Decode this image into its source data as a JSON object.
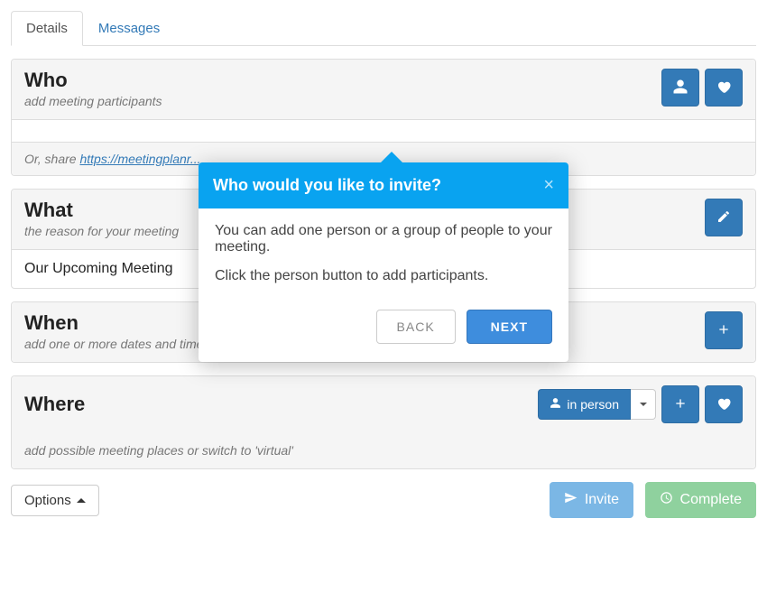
{
  "tabs": {
    "details": "Details",
    "messages": "Messages"
  },
  "who": {
    "title": "Who",
    "sub": "add meeting participants",
    "share_prefix": "Or, share ",
    "share_link": "https://meetingplanr..."
  },
  "what": {
    "title": "What",
    "sub": "the reason for your meeting",
    "value": "Our Upcoming Meeting"
  },
  "when": {
    "title": "When",
    "sub": "add one or more dates and times for participants to choose from"
  },
  "where": {
    "title": "Where",
    "sub": "add possible meeting places or switch to 'virtual'",
    "in_person": "in person"
  },
  "footer": {
    "options": "Options",
    "invite": "Invite",
    "complete": "Complete"
  },
  "popover": {
    "title": "Who would you like to invite?",
    "p1": "You can add one person or a group of people to your meeting.",
    "p2": "Click the person button to add participants.",
    "back": "BACK",
    "next": "NEXT"
  }
}
